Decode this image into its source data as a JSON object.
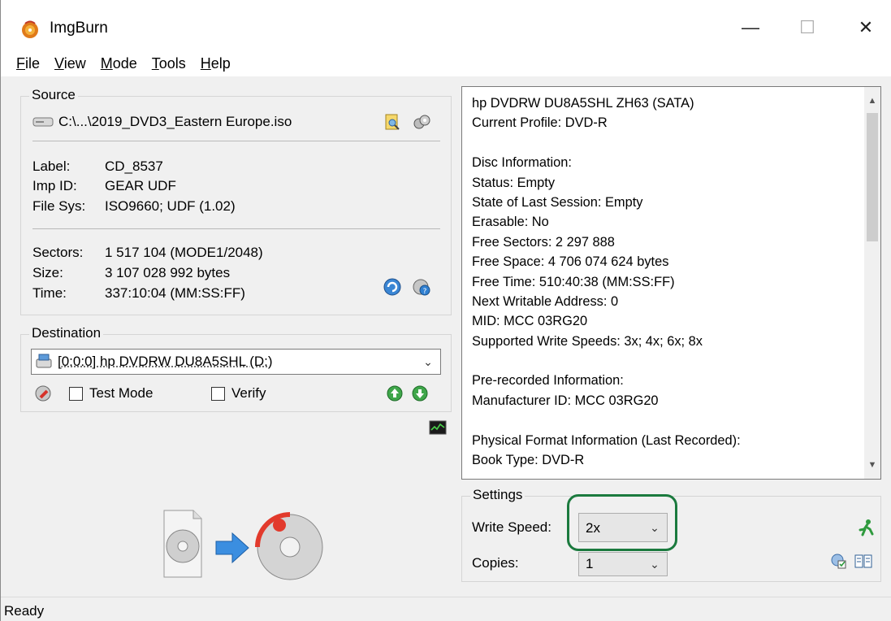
{
  "window": {
    "title": "ImgBurn",
    "minimize_glyph": "—",
    "maximize_glyph": "☐",
    "close_glyph": "✕"
  },
  "menu": [
    {
      "key": "F",
      "rest": "ile"
    },
    {
      "key": "V",
      "rest": "iew"
    },
    {
      "key": "M",
      "rest": "ode"
    },
    {
      "key": "T",
      "rest": "ools"
    },
    {
      "key": "H",
      "rest": "elp"
    }
  ],
  "source": {
    "group_label": "Source",
    "file_path": "C:\\...\\2019_DVD3_Eastern Europe.iso",
    "label_key": "Label:",
    "label_value": "CD_8537",
    "imp_key": "Imp ID:",
    "imp_value": "GEAR UDF",
    "fs_key": "File Sys:",
    "fs_value": "ISO9660; UDF (1.02)",
    "sectors_key": "Sectors:",
    "sectors_value": "1 517 104 (MODE1/2048)",
    "size_key": "Size:",
    "size_value": "3 107 028 992 bytes",
    "time_key": "Time:",
    "time_value": "337:10:04 (MM:SS:FF)"
  },
  "destination": {
    "group_label": "Destination",
    "drive": "[0:0:0] hp DVDRW  DU8A5SHL (D:)",
    "test_mode_label": "Test Mode",
    "verify_label": "Verify"
  },
  "info_lines": [
    "hp DVDRW  DU8A5SHL ZH63 (SATA)",
    "Current Profile: DVD-R",
    "",
    "Disc Information:",
    "Status: Empty",
    "State of Last Session: Empty",
    "Erasable: No",
    "Free Sectors: 2 297 888",
    "Free Space: 4 706 074 624 bytes",
    "Free Time: 510:40:38 (MM:SS:FF)",
    "Next Writable Address: 0",
    "MID: MCC 03RG20",
    "Supported Write Speeds: 3x; 4x; 6x; 8x",
    "",
    "Pre-recorded Information:",
    "Manufacturer ID: MCC 03RG20",
    "",
    "Physical Format Information (Last Recorded):",
    "Book Type: DVD-R"
  ],
  "settings": {
    "group_label": "Settings",
    "write_speed_label": "Write Speed:",
    "write_speed_value": "2x",
    "copies_label": "Copies:",
    "copies_value": "1"
  },
  "status": {
    "text": "Ready"
  },
  "colors": {
    "highlight": "#1b7a3e",
    "accent_blue": "#2f7fd1"
  }
}
